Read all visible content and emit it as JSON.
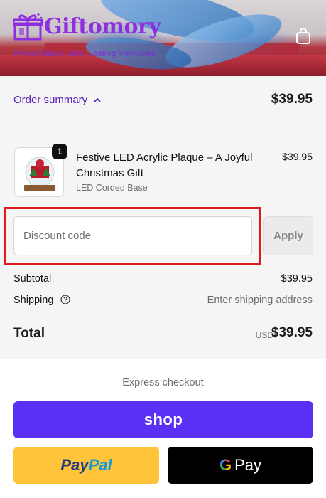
{
  "header": {
    "brand_name": "Giftomory",
    "tagline": "Personalized Gifts, Lasting Memories",
    "cart_icon": "shopping-bag-icon",
    "brand_color": "#8e2ee0"
  },
  "order_summary": {
    "toggle_label": "Order summary",
    "toggle_icon": "chevron-up-icon",
    "total": "$39.95",
    "item": {
      "quantity": "1",
      "title": "Festive LED Acrylic Plaque – A Joyful Christmas Gift",
      "variant": "LED Corded Base",
      "price": "$39.95"
    },
    "discount": {
      "placeholder": "Discount code",
      "value": "",
      "apply_label": "Apply"
    },
    "subtotal_label": "Subtotal",
    "subtotal_value": "$39.95",
    "shipping_label": "Shipping",
    "shipping_value": "Enter shipping address",
    "total_label": "Total",
    "currency": "USD",
    "total_value": "$39.95"
  },
  "express": {
    "title": "Express checkout",
    "shop_label": "shop",
    "paypal_pay": "Pay",
    "paypal_pal": "Pal",
    "gpay_g": "G",
    "gpay_label": "Pay",
    "shop_color": "#5a31f4",
    "paypal_color": "#ffc439",
    "gpay_color": "#000000"
  }
}
